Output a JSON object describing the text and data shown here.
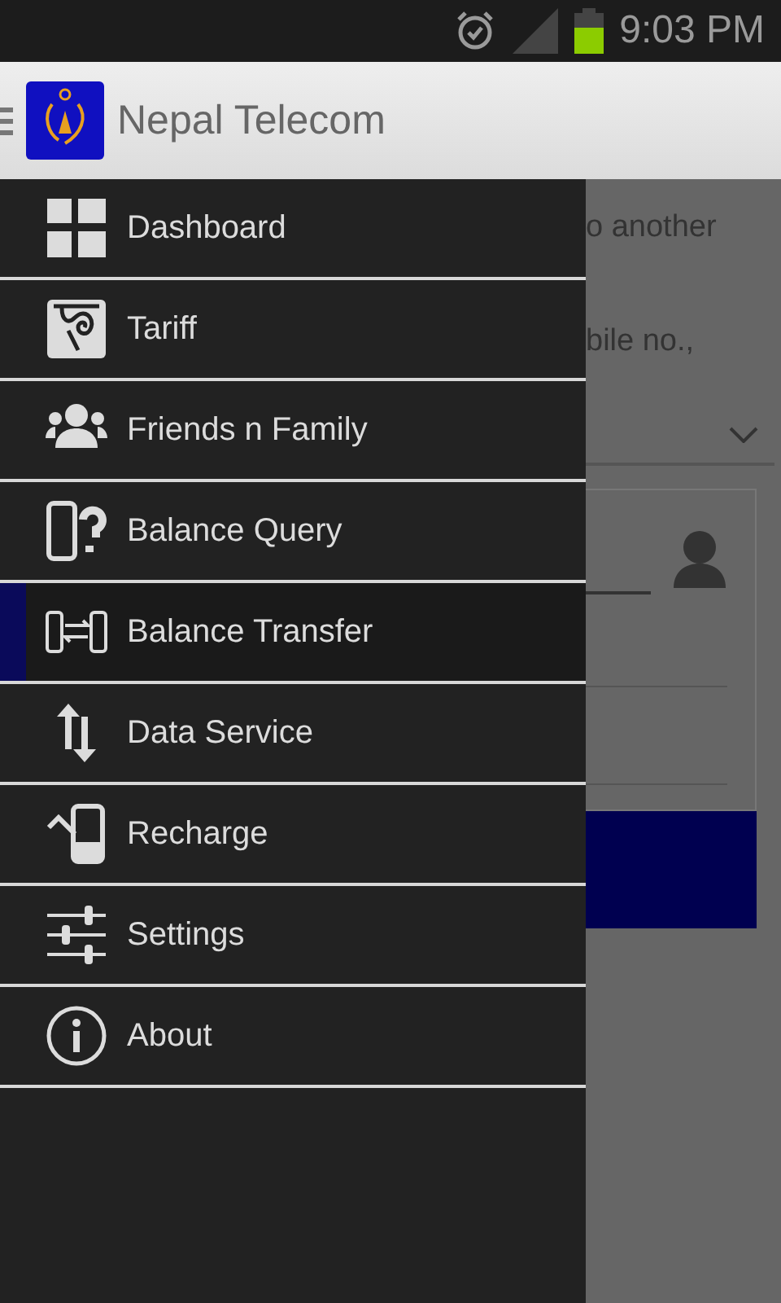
{
  "status_bar": {
    "time": "9:03 PM"
  },
  "app_bar": {
    "title": "Nepal Telecom"
  },
  "menu": [
    {
      "kind": "dashboard",
      "label": "Dashboard",
      "selected": false
    },
    {
      "kind": "tariff",
      "label": "Tariff",
      "selected": false
    },
    {
      "kind": "friends",
      "label": "Friends n Family",
      "selected": false
    },
    {
      "kind": "query",
      "label": "Balance Query",
      "selected": false
    },
    {
      "kind": "transfer",
      "label": "Balance Transfer",
      "selected": true
    },
    {
      "kind": "data",
      "label": "Data Service",
      "selected": false
    },
    {
      "kind": "recharge",
      "label": "Recharge",
      "selected": false
    },
    {
      "kind": "settings",
      "label": "Settings",
      "selected": false
    },
    {
      "kind": "about",
      "label": "About",
      "selected": false
    }
  ],
  "background": {
    "texts": [
      "o another",
      "bile no.,"
    ]
  }
}
